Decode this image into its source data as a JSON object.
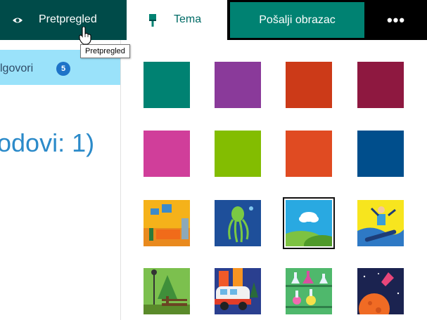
{
  "toolbar": {
    "preview_label": "Pretpregled",
    "theme_label": "Tema",
    "send_label": "Pošalji obrazac",
    "more_label": "•••"
  },
  "tooltip": {
    "text": "Pretpregled"
  },
  "left_panel": {
    "responses_tab_label": "lgovori",
    "responses_count": "5",
    "heading_fragment": "odovi: 1)"
  },
  "themes": {
    "selected_index": 10,
    "swatches": [
      {
        "type": "color",
        "color": "#008272"
      },
      {
        "type": "color",
        "color": "#8a3a9a"
      },
      {
        "type": "color",
        "color": "#cc3a18"
      },
      {
        "type": "color",
        "color": "#8e1840"
      },
      {
        "type": "color",
        "color": "#d03e9a"
      },
      {
        "type": "color",
        "color": "#83bd01"
      },
      {
        "type": "color",
        "color": "#e04b22"
      },
      {
        "type": "color",
        "color": "#004e8c"
      },
      {
        "type": "image",
        "name": "living-room-theme"
      },
      {
        "type": "image",
        "name": "octopus-theme"
      },
      {
        "type": "image",
        "name": "sky-hills-theme"
      },
      {
        "type": "image",
        "name": "snowboarder-theme"
      },
      {
        "type": "image",
        "name": "park-bench-theme"
      },
      {
        "type": "image",
        "name": "city-bus-theme"
      },
      {
        "type": "image",
        "name": "lab-flasks-theme"
      },
      {
        "type": "image",
        "name": "space-rocket-theme"
      }
    ]
  }
}
